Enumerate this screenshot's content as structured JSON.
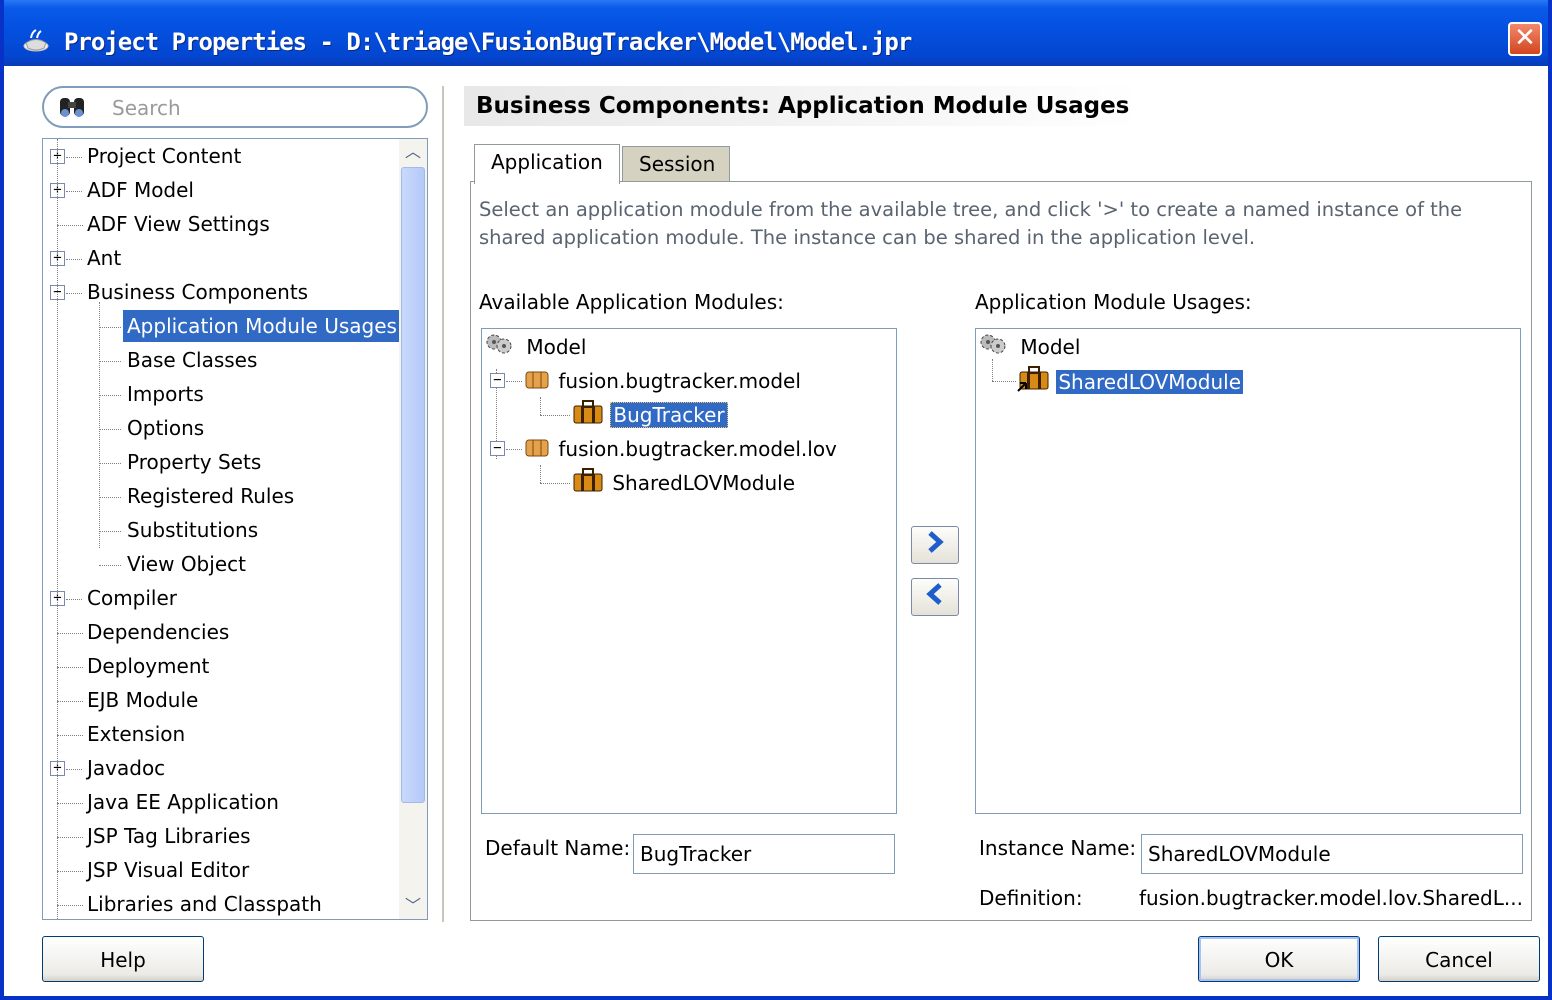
{
  "window": {
    "title": "Project Properties - D:\\triage\\FusionBugTracker\\Model\\Model.jpr",
    "close_glyph": "✕"
  },
  "search": {
    "placeholder": "Search",
    "value": ""
  },
  "nav": {
    "items": [
      {
        "label": "Project Content",
        "expander": "+"
      },
      {
        "label": "ADF Model",
        "expander": "+"
      },
      {
        "label": "ADF View Settings"
      },
      {
        "label": "Ant",
        "expander": "+"
      },
      {
        "label": "Business Components",
        "expander": "−"
      },
      {
        "label": "Application Module Usages",
        "selected": true
      },
      {
        "label": "Base Classes"
      },
      {
        "label": "Imports"
      },
      {
        "label": "Options"
      },
      {
        "label": "Property Sets"
      },
      {
        "label": "Registered Rules"
      },
      {
        "label": "Substitutions"
      },
      {
        "label": "View Object"
      },
      {
        "label": "Compiler",
        "expander": "+"
      },
      {
        "label": "Dependencies"
      },
      {
        "label": "Deployment"
      },
      {
        "label": "EJB Module"
      },
      {
        "label": "Extension"
      },
      {
        "label": "Javadoc",
        "expander": "+"
      },
      {
        "label": "Java EE Application"
      },
      {
        "label": "JSP Tag Libraries"
      },
      {
        "label": "JSP Visual Editor"
      },
      {
        "label": "Libraries and Classpath"
      }
    ],
    "scroll_up": "︿",
    "scroll_down": "﹀"
  },
  "section_title": "Business Components: Application Module Usages",
  "tabs": [
    {
      "label": "Application",
      "active": true
    },
    {
      "label": "Session",
      "active": false
    }
  ],
  "description": "Select an application module from the available tree, and click '>' to create a named instance of the shared application module. The instance can be shared in the application level.",
  "available": {
    "label": "Available Application Modules:",
    "tree": {
      "root": "Model",
      "packages": [
        {
          "label": "fusion.bugtracker.model",
          "expander": "−",
          "modules": [
            {
              "label": "BugTracker",
              "selected": true
            }
          ]
        },
        {
          "label": "fusion.bugtracker.model.lov",
          "expander": "−",
          "modules": [
            {
              "label": "SharedLOVModule",
              "selected": false
            }
          ]
        }
      ]
    },
    "default_name_label": "Default Name:",
    "default_name_value": "BugTracker"
  },
  "usages": {
    "label": "Application Module Usages:",
    "tree": {
      "root": "Model",
      "items": [
        {
          "label": "SharedLOVModule",
          "selected": true
        }
      ]
    },
    "instance_name_label": "Instance Name:",
    "instance_name_value": "SharedLOVModule",
    "definition_label": "Definition:",
    "definition_value": "fusion.bugtracker.model.lov.SharedL..."
  },
  "shuttle": {
    "add": "›",
    "remove": "‹"
  },
  "buttons": {
    "help": "Help",
    "ok": "OK",
    "cancel": "Cancel"
  },
  "colors": {
    "selection": "#316ac5",
    "titlebar": "#0450e0",
    "close": "#d2451f"
  }
}
